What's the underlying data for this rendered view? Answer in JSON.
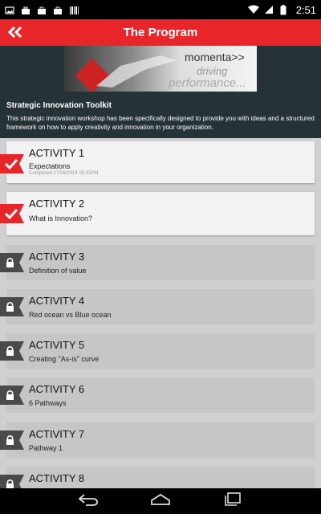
{
  "status_bar": {
    "time": "2:51",
    "icons": [
      "image-icon",
      "briefcase-icon",
      "shopping-bag-icon",
      "shopping-bag-icon",
      "barcode-icon",
      "wifi-icon",
      "signal-icon",
      "battery-icon"
    ]
  },
  "app_bar": {
    "back_icon": "double-chevron-left-icon",
    "title": "The Program"
  },
  "banner": {
    "brand": "momenta>>",
    "tagline_1": "driving",
    "tagline_2": "performance..."
  },
  "program": {
    "title": "Strategic Innovation Toolkit",
    "description": "This strategic innovation workshop has been specifically designed to provide you with ideas and a structured framework on how to apply creativity and innovation in your organization."
  },
  "activities": [
    {
      "title": "ACTIVITY 1",
      "subtitle": "Expectations",
      "meta": "Completed 27/06/2014 05:33PM",
      "status": "completed",
      "badge_icon": "checkmark-icon"
    },
    {
      "title": "ACTIVITY 2",
      "subtitle": "What is Innovation?",
      "status": "unlocked",
      "badge_icon": "checkmark-icon"
    },
    {
      "title": "ACTIVITY 3",
      "subtitle": "Definition of value",
      "status": "locked",
      "badge_icon": "lock-icon"
    },
    {
      "title": "ACTIVITY 4",
      "subtitle": "Red ocean vs Blue ocean",
      "status": "locked",
      "badge_icon": "lock-icon"
    },
    {
      "title": "ACTIVITY 5",
      "subtitle": "Creating \"As-is\" curve",
      "status": "locked",
      "badge_icon": "lock-icon"
    },
    {
      "title": "ACTIVITY 6",
      "subtitle": "6 Pathways",
      "status": "locked",
      "badge_icon": "lock-icon"
    },
    {
      "title": "ACTIVITY 7",
      "subtitle": "Pathway 1",
      "status": "locked",
      "badge_icon": "lock-icon"
    },
    {
      "title": "ACTIVITY 8",
      "subtitle": "",
      "status": "locked",
      "badge_icon": "lock-icon"
    }
  ],
  "nav_bar": {
    "buttons": [
      "back-icon",
      "home-icon",
      "recents-icon"
    ]
  },
  "colors": {
    "accent": "#e8262a",
    "header_bg": "#253236",
    "locked_badge": "#4a4a4a",
    "card_bg": "#f2f2f2",
    "locked_card_bg": "#c6c6c6"
  }
}
